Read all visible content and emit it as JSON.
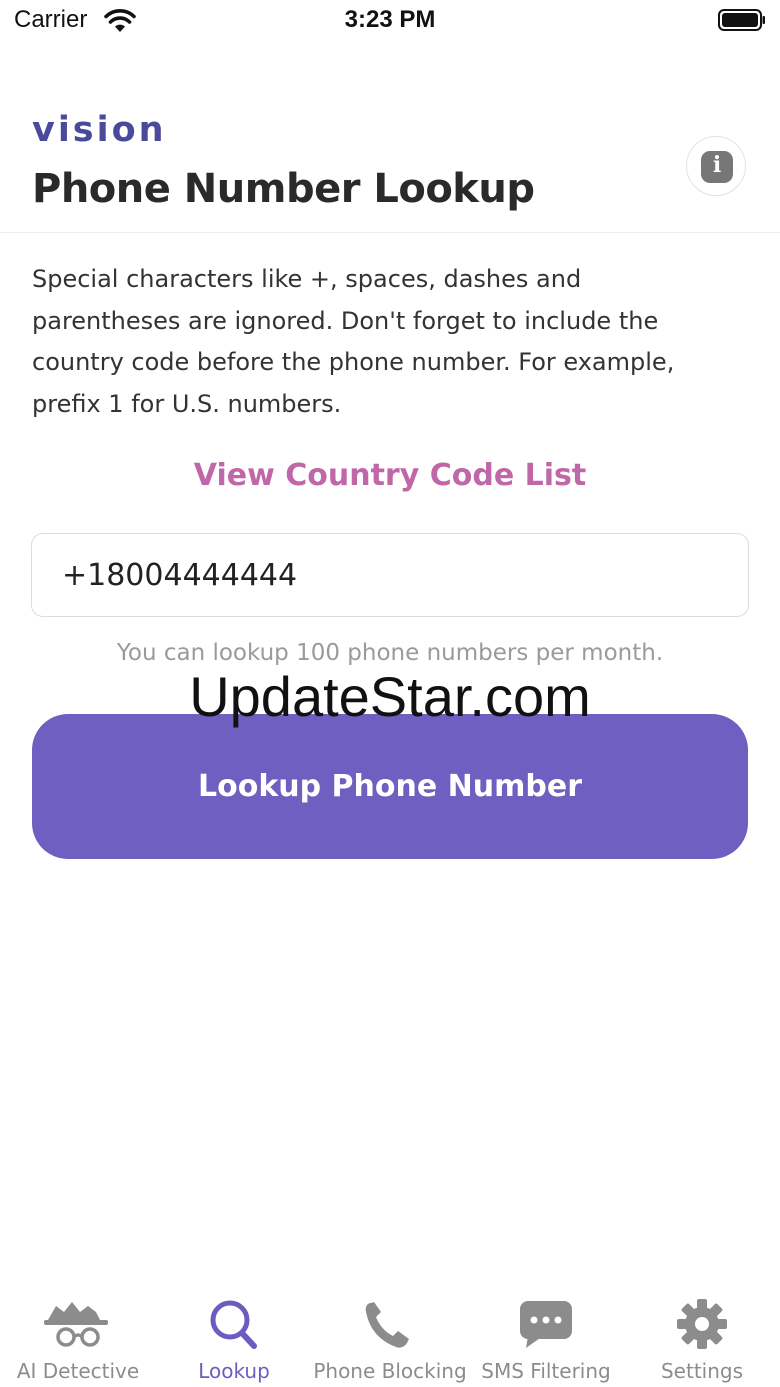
{
  "status_bar": {
    "carrier": "Carrier",
    "time": "3:23 PM"
  },
  "header": {
    "brand": "vision",
    "title": "Phone Number Lookup",
    "info_icon": "info-icon"
  },
  "main": {
    "instructions": "Special characters like +, spaces, dashes and parentheses are ignored. Don't forget to include the country code before the phone number. For example, prefix 1 for U.S. numbers.",
    "country_code_link": "View Country Code List",
    "phone_input_value": "+18004444444",
    "quota_text": "You can lookup 100 phone numbers per month.",
    "watermark": "UpdateStar.com",
    "lookup_button": "Lookup Phone Number"
  },
  "tabs": [
    {
      "label": "AI Detective",
      "icon": "detective-icon",
      "active": false
    },
    {
      "label": "Lookup",
      "icon": "search-icon",
      "active": true
    },
    {
      "label": "Phone Blocking",
      "icon": "phone-icon",
      "active": false
    },
    {
      "label": "SMS Filtering",
      "icon": "message-icon",
      "active": false
    },
    {
      "label": "Settings",
      "icon": "gear-icon",
      "active": false
    }
  ],
  "colors": {
    "accent": "#6e5fc1",
    "brand": "#4a4a9c",
    "link": "#c067a8",
    "inactive_tab": "#8c8c8c"
  }
}
